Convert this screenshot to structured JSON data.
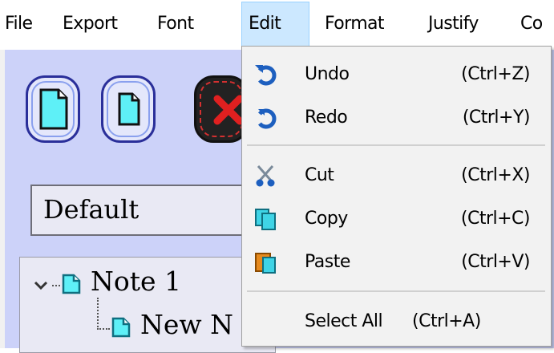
{
  "menubar": {
    "items": [
      {
        "label": "File"
      },
      {
        "label": "Export"
      },
      {
        "label": "Font"
      },
      {
        "label": "Edit"
      },
      {
        "label": "Format"
      },
      {
        "label": "Justify"
      },
      {
        "label": "Co"
      }
    ],
    "active": "Edit"
  },
  "toolbar": {
    "buttons": [
      {
        "icon": "new-document-icon"
      },
      {
        "icon": "new-child-document-icon"
      },
      {
        "icon": "delete-icon"
      }
    ]
  },
  "font_select": {
    "value": "Default"
  },
  "tree": {
    "nodes": [
      {
        "label": "Note 1",
        "expanded": true
      },
      {
        "label": "New N"
      }
    ]
  },
  "edit_menu": {
    "items": [
      {
        "label": "Undo",
        "shortcut": "(Ctrl+Z)",
        "icon": "undo-icon"
      },
      {
        "label": "Redo",
        "shortcut": "(Ctrl+Y)",
        "icon": "redo-icon"
      },
      {
        "label": "Cut",
        "shortcut": "(Ctrl+X)",
        "icon": "scissors-icon"
      },
      {
        "label": "Copy",
        "shortcut": "(Ctrl+C)",
        "icon": "copy-icon"
      },
      {
        "label": "Paste",
        "shortcut": "(Ctrl+V)",
        "icon": "paste-icon"
      },
      {
        "label": "Select All",
        "shortcut": "(Ctrl+A)"
      }
    ]
  },
  "colors": {
    "app_background": "#ccd2f9",
    "menu_highlight": "#cce8ff",
    "icon_blue": "#1d5fbf",
    "icon_cyan": "#3fd4e6",
    "icon_orange": "#e68a1e"
  }
}
